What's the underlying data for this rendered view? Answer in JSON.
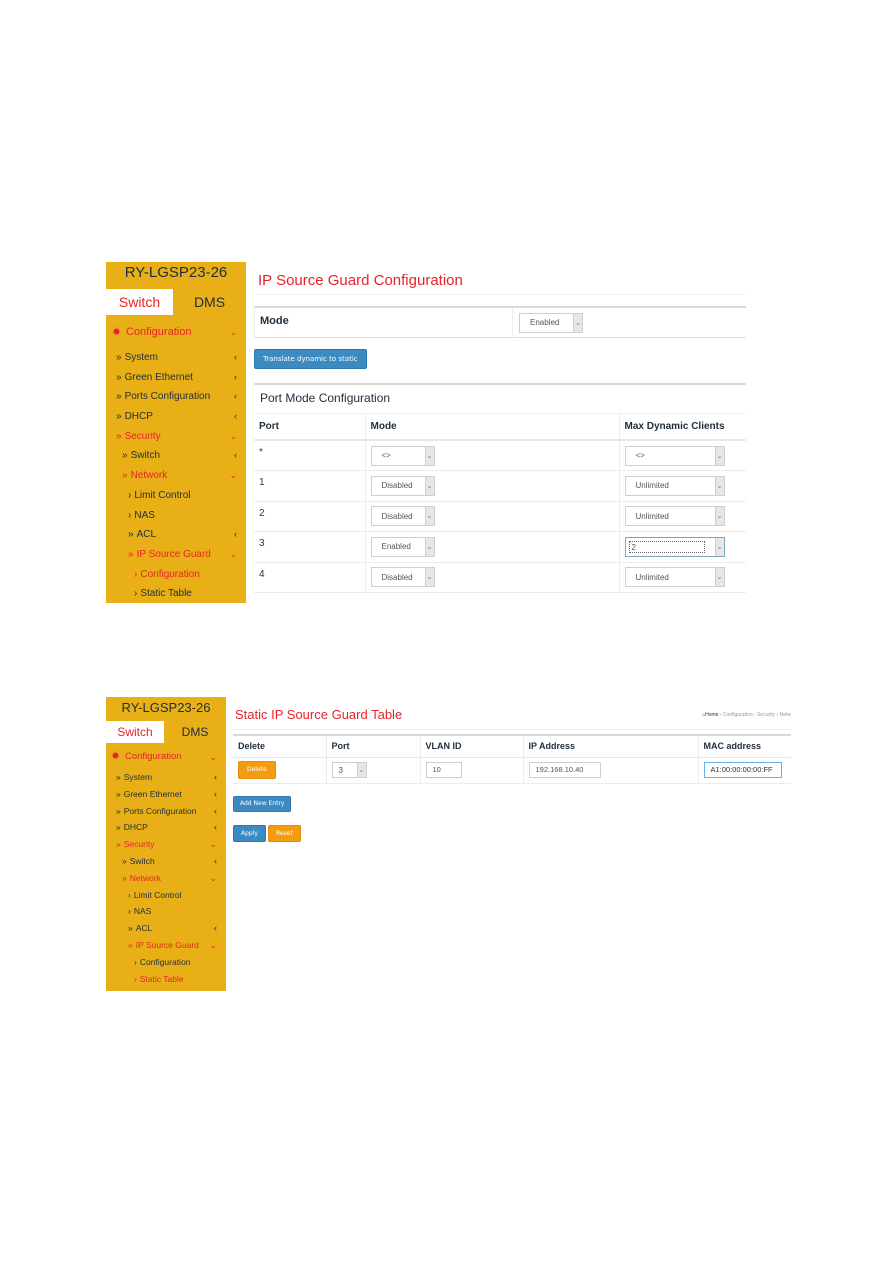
{
  "colors": {
    "sidebar_bg": "#e8b016",
    "accent_red": "#e8222a",
    "primary_blue": "#3b8bc2",
    "warning_orange": "#f39c12"
  },
  "sidebar": {
    "brand": "RY-LGSP23-26",
    "tabs": [
      {
        "label": "Switch",
        "active": true
      },
      {
        "label": "DMS",
        "active": false
      }
    ],
    "config_label": "Configuration",
    "items": {
      "system": "System",
      "green_ethernet": "Green Ethernet",
      "ports_configuration": "Ports Configuration",
      "dhcp": "DHCP",
      "security": "Security",
      "switch": "Switch",
      "network": "Network",
      "limit_control": "Limit Control",
      "nas": "NAS",
      "acl": "ACL",
      "ip_source_guard": "IP Source Guard",
      "configuration": "Configuration",
      "static_table": "Static Table"
    },
    "glyphs": {
      "double_chevron": "»",
      "single_chevron": "›",
      "collapsed": "‹",
      "expanded": "⌄"
    }
  },
  "screen1": {
    "title": "IP Source Guard Configuration",
    "mode_label": "Mode",
    "mode_value": "Enabled",
    "translate_button": "Translate dynamic to static",
    "section_title": "Port Mode Configuration",
    "columns": [
      "Port",
      "Mode",
      "Max Dynamic Clients"
    ],
    "rows": [
      {
        "port": "*",
        "mode": "<>",
        "max_clients": "<>"
      },
      {
        "port": "1",
        "mode": "Disabled",
        "max_clients": "Unlimited"
      },
      {
        "port": "2",
        "mode": "Disabled",
        "max_clients": "Unlimited"
      },
      {
        "port": "3",
        "mode": "Enabled",
        "max_clients": "2"
      },
      {
        "port": "4",
        "mode": "Disabled",
        "max_clients": "Unlimited"
      }
    ]
  },
  "screen2": {
    "title": "Static IP Source Guard Table",
    "breadcrumb": [
      "Home",
      "Configuration",
      "Security",
      "Netw"
    ],
    "columns": [
      "Delete",
      "Port",
      "VLAN ID",
      "IP Address",
      "MAC address"
    ],
    "entry": {
      "delete_label": "Delete",
      "port": "3",
      "vlan_id": "10",
      "ip_address": "192.168.10.40",
      "mac_address": "A1:00:00:00:00:FF"
    },
    "add_new_entry": "Add New Entry",
    "apply": "Apply",
    "reset": "Reset"
  }
}
